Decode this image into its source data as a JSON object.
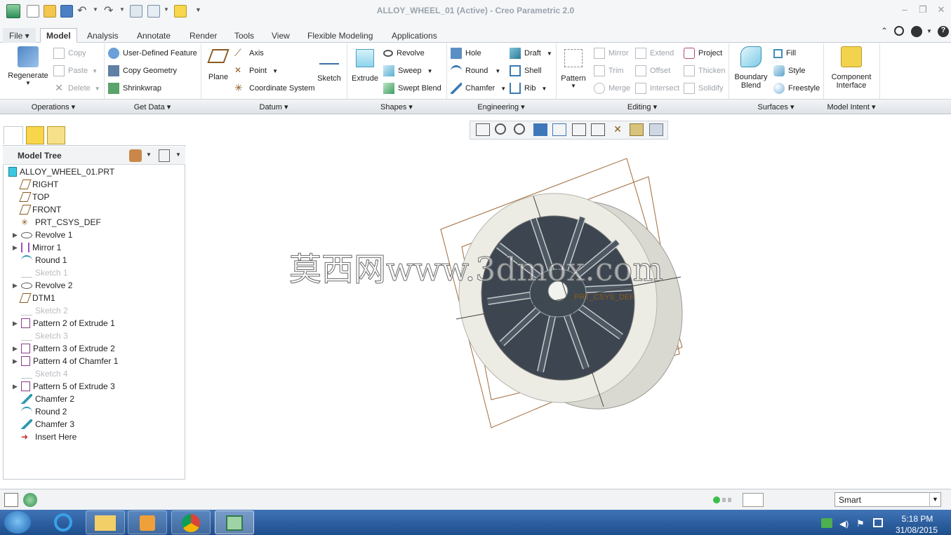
{
  "window": {
    "title": "ALLOY_WHEEL_01 (Active) - Creo Parametric 2.0"
  },
  "tabs": [
    {
      "label": "File"
    },
    {
      "label": "Model"
    },
    {
      "label": "Analysis"
    },
    {
      "label": "Annotate"
    },
    {
      "label": "Render"
    },
    {
      "label": "Tools"
    },
    {
      "label": "View"
    },
    {
      "label": "Flexible Modeling"
    },
    {
      "label": "Applications"
    }
  ],
  "ribbon": {
    "operations": {
      "regenerate": "Regenerate",
      "copy": "Copy",
      "paste": "Paste",
      "delete": "Delete",
      "group": "Operations"
    },
    "getdata": {
      "udf": "User-Defined Feature",
      "copygeom": "Copy Geometry",
      "shrinkwrap": "Shrinkwrap",
      "group": "Get Data"
    },
    "datum": {
      "plane": "Plane",
      "axis": "Axis",
      "point": "Point",
      "csys": "Coordinate System",
      "sketch": "Sketch",
      "group": "Datum"
    },
    "shapes": {
      "extrude": "Extrude",
      "revolve": "Revolve",
      "sweep": "Sweep",
      "sweptblend": "Swept Blend",
      "group": "Shapes"
    },
    "engineering": {
      "hole": "Hole",
      "round": "Round",
      "chamfer": "Chamfer",
      "draft": "Draft",
      "shell": "Shell",
      "rib": "Rib",
      "group": "Engineering"
    },
    "editing": {
      "pattern": "Pattern",
      "mirror": "Mirror",
      "trim": "Trim",
      "merge": "Merge",
      "extend": "Extend",
      "offset": "Offset",
      "intersect": "Intersect",
      "project": "Project",
      "thicken": "Thicken",
      "solidify": "Solidify",
      "group": "Editing"
    },
    "surfaces": {
      "boundary1": "Boundary",
      "boundary2": "Blend",
      "fill": "Fill",
      "style": "Style",
      "freestyle": "Freestyle",
      "group": "Surfaces"
    },
    "modelintent": {
      "ci1": "Component",
      "ci2": "Interface",
      "group": "Model Intent"
    }
  },
  "tree": {
    "header": "Model Tree",
    "items": [
      {
        "label": "ALLOY_WHEEL_01.PRT",
        "icon": "part-icon",
        "dim": false,
        "expander": false
      },
      {
        "label": "RIGHT",
        "icon": "datum-plane-icon",
        "dim": false,
        "expander": false
      },
      {
        "label": "TOP",
        "icon": "datum-plane-icon",
        "dim": false,
        "expander": false
      },
      {
        "label": "FRONT",
        "icon": "datum-plane-icon",
        "dim": false,
        "expander": false
      },
      {
        "label": "PRT_CSYS_DEF",
        "icon": "csys-icon",
        "dim": false,
        "expander": false
      },
      {
        "label": "Revolve 1",
        "icon": "revolve-icon",
        "dim": false,
        "expander": true
      },
      {
        "label": "Mirror 1",
        "icon": "mirror-icon",
        "dim": false,
        "expander": true
      },
      {
        "label": "Round 1",
        "icon": "round-icon",
        "dim": false,
        "expander": false
      },
      {
        "label": "Sketch 1",
        "icon": "sketch-icon",
        "dim": true,
        "expander": false
      },
      {
        "label": "Revolve 2",
        "icon": "revolve-icon",
        "dim": false,
        "expander": true
      },
      {
        "label": "DTM1",
        "icon": "datum-plane-icon",
        "dim": false,
        "expander": false
      },
      {
        "label": "Sketch 2",
        "icon": "sketch-icon",
        "dim": true,
        "expander": false
      },
      {
        "label": "Pattern 2 of Extrude 1",
        "icon": "pattern-icon",
        "dim": false,
        "expander": true
      },
      {
        "label": "Sketch 3",
        "icon": "sketch-icon",
        "dim": true,
        "expander": false
      },
      {
        "label": "Pattern 3 of Extrude 2",
        "icon": "pattern-icon",
        "dim": false,
        "expander": true
      },
      {
        "label": "Pattern 4 of Chamfer 1",
        "icon": "pattern-icon",
        "dim": false,
        "expander": true
      },
      {
        "label": "Sketch 4",
        "icon": "sketch-icon",
        "dim": true,
        "expander": false
      },
      {
        "label": "Pattern 5 of Extrude 3",
        "icon": "pattern-icon",
        "dim": false,
        "expander": true
      },
      {
        "label": "Chamfer 2",
        "icon": "chamfer-icon",
        "dim": false,
        "expander": false
      },
      {
        "label": "Round 2",
        "icon": "round-icon",
        "dim": false,
        "expander": false
      },
      {
        "label": "Chamfer 3",
        "icon": "chamfer-icon",
        "dim": false,
        "expander": false
      },
      {
        "label": "Insert Here",
        "icon": "insert-arrow-icon",
        "dim": false,
        "expander": false
      }
    ]
  },
  "viewport": {
    "watermark": "莫西网www.3dmox.com",
    "csys_label": "PRT_CSYS_DEF"
  },
  "status": {
    "filter": "Smart"
  },
  "taskbar": {
    "time": "5:18 PM",
    "date": "31/08/2015"
  }
}
